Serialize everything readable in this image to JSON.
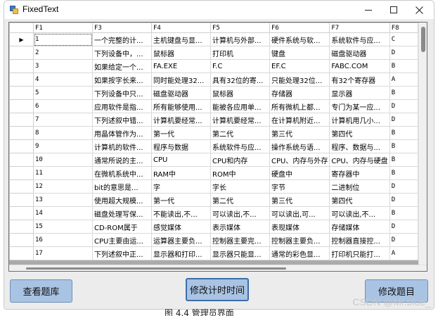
{
  "window": {
    "title": "FixedText"
  },
  "grid": {
    "columns": [
      "F1",
      "F3",
      "F4",
      "F5",
      "F6",
      "F7",
      "F8"
    ],
    "selected_row_marker": "▶",
    "rows": [
      [
        "1",
        "一个完整的计...",
        "主机键盘与显...",
        "计算机与外部...",
        "硬件系统与软...",
        "系统软件与应...",
        "C"
      ],
      [
        "2",
        "下列设备中，...",
        "鼠标器",
        "打印机",
        "键盘",
        "磁盘驱动器",
        "D"
      ],
      [
        "3",
        "如果给定一个...",
        "FA.EXE",
        "F.C",
        "EF.C",
        "FABC.COM",
        "B"
      ],
      [
        "4",
        "如果按字长来...",
        "同时能处理32...",
        "具有32位的寄...",
        "只能处理32位...",
        "有32个寄存器",
        "A"
      ],
      [
        "5",
        "下列设备中只...",
        "磁盘驱动器",
        "鼠标器",
        "存储器",
        "显示器",
        "B"
      ],
      [
        "6",
        "应用软件是指...",
        "所有能够使用...",
        "能被各应用单...",
        "所有微机上都...",
        "专门为某一应...",
        "D"
      ],
      [
        "7",
        "下列述叙中错...",
        "计算机要经常...",
        "计算机要经常...",
        "在计算机附近...",
        "计算机用几小...",
        "D"
      ],
      [
        "8",
        "用晶体管作为...",
        "第一代",
        "第二代",
        "第三代",
        "第四代",
        "B"
      ],
      [
        "9",
        "计算机的软件...",
        "程序与数据",
        "系统软件与应...",
        "操作系统与语...",
        "程序、数据与...",
        "B"
      ],
      [
        "10",
        "通常所说的主...",
        "CPU",
        "CPU和内存",
        "CPU、内存与外存",
        "CPU、内存与硬盘",
        "B"
      ],
      [
        "11",
        "在微机系统中...",
        "RAM中",
        "ROM中",
        "硬盘中",
        "寄存器中",
        "B"
      ],
      [
        "12",
        "bit的意思是...",
        "字",
        "字长",
        "字节",
        "二进制位",
        "D"
      ],
      [
        "13",
        "使用超大规模...",
        "第一代",
        "第二代",
        "第三代",
        "第四代",
        "D"
      ],
      [
        "14",
        "磁盘处理写保...",
        "不能读出,不...",
        "可以读出,不...",
        "可以读出,可...",
        "可以读出,不...",
        "B"
      ],
      [
        "15",
        "CD-ROM属于",
        "感觉媒体",
        "表示媒体",
        "表现媒体",
        "存储媒体",
        "D"
      ],
      [
        "16",
        "CPU主要由运...",
        "运算器主要负...",
        "控制器主要完...",
        "控制器主要负...",
        "控制器直接控...",
        "D"
      ],
      [
        "17",
        "下列述叙中正...",
        "显示器和打印...",
        "显示器只能显...",
        "通常的彩色显...",
        "打印机只能打...",
        "A"
      ]
    ]
  },
  "buttons": {
    "view_bank": "查看题库",
    "edit_timer": "修改计时时间",
    "edit_question": "修改题目"
  },
  "caption": "图 4.4  管理员界面",
  "watermark": "CSDN @Mr.blue_"
}
